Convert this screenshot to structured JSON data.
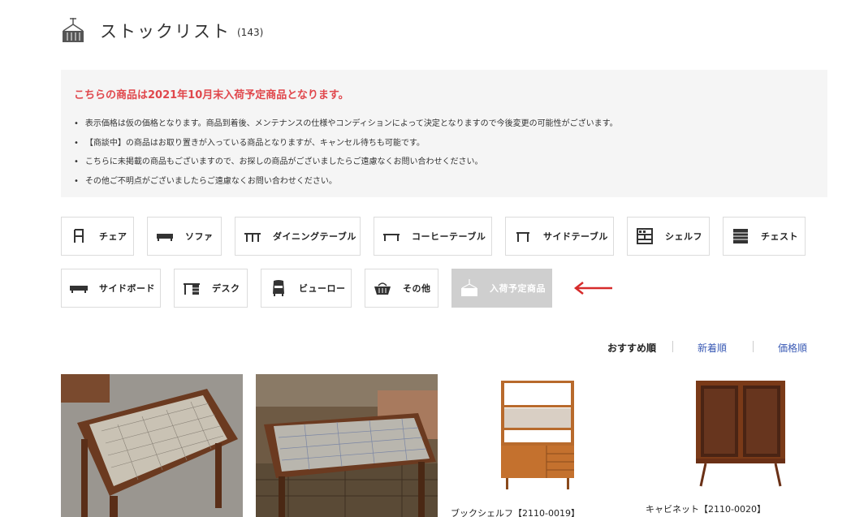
{
  "header": {
    "title": "ストックリスト",
    "count": "(143)",
    "icon": "container-crane-icon"
  },
  "notice": {
    "title": "こちらの商品は2021年10月末入荷予定商品となります。",
    "items": [
      "表示価格は仮の価格となります。商品到着後、メンテナンスの仕様やコンディションによって決定となりますので今後変更の可能性がございます。",
      "【商談中】の商品はお取り置きが入っている商品となりますが、キャンセル待ちも可能です。",
      "こちらに未掲載の商品もございますので、お探しの商品がございましたらご遠慮なくお問い合わせください。",
      "その他ご不明点がございましたらご遠慮なくお問い合わせください。"
    ]
  },
  "categories": [
    {
      "label": "チェア",
      "icon": "chair-icon"
    },
    {
      "label": "ソファ",
      "icon": "sofa-icon"
    },
    {
      "label": "ダイニングテーブル",
      "icon": "dining-table-icon"
    },
    {
      "label": "コーヒーテーブル",
      "icon": "coffee-table-icon"
    },
    {
      "label": "サイドテーブル",
      "icon": "side-table-icon"
    },
    {
      "label": "シェルフ",
      "icon": "shelf-icon"
    },
    {
      "label": "チェスト",
      "icon": "chest-icon"
    },
    {
      "label": "サイドボード",
      "icon": "sideboard-icon"
    },
    {
      "label": "デスク",
      "icon": "desk-icon"
    },
    {
      "label": "ビューロー",
      "icon": "bureau-icon"
    },
    {
      "label": "その他",
      "icon": "basket-icon"
    },
    {
      "label": "入荷予定商品",
      "icon": "container-crane-icon"
    }
  ],
  "sort": {
    "recommended": "おすすめ順",
    "newest": "新着順",
    "price": "価格順"
  },
  "products": [
    {
      "name": "",
      "image": "tiled-coffee-table-photo"
    },
    {
      "name": "",
      "image": "tiled-coffee-table-photo"
    },
    {
      "name": "ブックシェルフ【2110-0019】",
      "image": "bookshelf-photo"
    },
    {
      "name": "キャビネット【2110-0020】",
      "image": "cabinet-photo"
    }
  ],
  "colors": {
    "notice_title": "#e0474c",
    "sort_link": "#3b5bb5",
    "active_category": "#cfcfcf",
    "arrow": "#d62b2b"
  }
}
